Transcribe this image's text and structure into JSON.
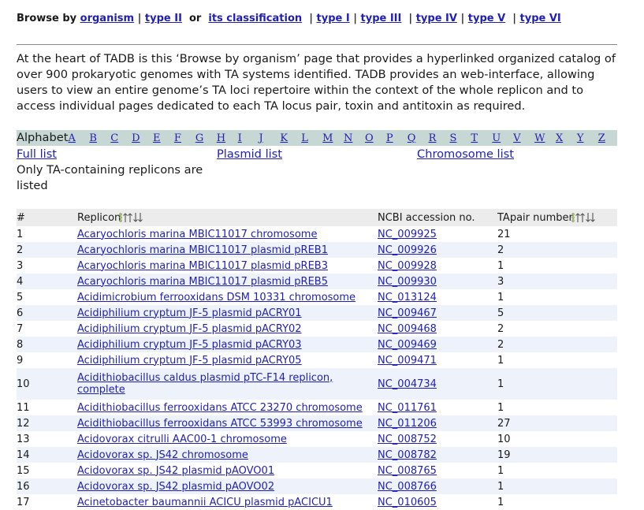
{
  "nav": {
    "prefix": "Browse by",
    "organism": "organism",
    "sep1": "|",
    "type2": "type II",
    "or": "or",
    "classification": "its classification",
    "types": [
      {
        "sep": "|",
        "label": "type I"
      },
      {
        "sep": "|",
        "label": "type III"
      },
      {
        "sep": "|",
        "label": "type IV"
      },
      {
        "sep": "|",
        "label": "type V"
      },
      {
        "sep": "|",
        "label": "type VI"
      }
    ]
  },
  "intro": "At the heart of TADB is this ‘Browse by organism’ page that provides a hyperlinked organized catalog of over 900 prokaryotic genomes with TA systems identified. TADB provides an web-interface, allowing users to view an entire genome’s TA loci repertoire within the context of the whole replicon and to access individual pages dedicated to each TA locus pair, toxin and antitoxin as required.",
  "alphabet": {
    "label": "Alphabet",
    "letters": [
      "A",
      "B",
      "C",
      "D",
      "E",
      "F",
      "G",
      "H",
      "I",
      "J",
      "K",
      "L",
      "M",
      "N",
      "O",
      "P",
      "Q",
      "R",
      "S",
      "T",
      "U",
      "V",
      "W",
      "X",
      "Y",
      "Z"
    ]
  },
  "lists": {
    "full": "Full list",
    "plasmid": "Plasmid list",
    "chromosome": "Chromosome list"
  },
  "note": "Only TA-containing replicons are listed",
  "table": {
    "headers": {
      "num": "#",
      "replicon": "Replicon",
      "accession": "NCBI accession no.",
      "tapair": "TApair number"
    },
    "rows": [
      {
        "num": "1",
        "replicon": "Acaryochloris marina MBIC11017 chromosome",
        "accession": "NC_009925",
        "tapair": "21"
      },
      {
        "num": "2",
        "replicon": "Acaryochloris marina MBIC11017 plasmid pREB1",
        "accession": "NC_009926",
        "tapair": "2"
      },
      {
        "num": "3",
        "replicon": "Acaryochloris marina MBIC11017 plasmid pREB3",
        "accession": "NC_009928",
        "tapair": "1"
      },
      {
        "num": "4",
        "replicon": "Acaryochloris marina MBIC11017 plasmid pREB5",
        "accession": "NC_009930",
        "tapair": "3"
      },
      {
        "num": "5",
        "replicon": "Acidimicrobium ferrooxidans DSM 10331 chromosome",
        "accession": "NC_013124",
        "tapair": "1"
      },
      {
        "num": "6",
        "replicon": "Acidiphilium cryptum JF-5 plasmid pACRY01",
        "accession": "NC_009467",
        "tapair": "5"
      },
      {
        "num": "7",
        "replicon": "Acidiphilium cryptum JF-5 plasmid pACRY02",
        "accession": "NC_009468",
        "tapair": "2"
      },
      {
        "num": "8",
        "replicon": "Acidiphilium cryptum JF-5 plasmid pACRY03",
        "accession": "NC_009469",
        "tapair": "2"
      },
      {
        "num": "9",
        "replicon": "Acidiphilium cryptum JF-5 plasmid pACRY05",
        "accession": "NC_009471",
        "tapair": "1"
      },
      {
        "num": "10",
        "replicon": "Acidithiobacillus caldus plasmid pTC-F14 replicon, complete",
        "accession": "NC_004734",
        "tapair": "1"
      },
      {
        "num": "11",
        "replicon": "Acidithiobacillus ferrooxidans ATCC 23270 chromosome",
        "accession": "NC_011761",
        "tapair": "1"
      },
      {
        "num": "12",
        "replicon": "Acidithiobacillus ferrooxidans ATCC 53993 chromosome",
        "accession": "NC_011206",
        "tapair": "27"
      },
      {
        "num": "13",
        "replicon": "Acidovorax citrulli AAC00-1 chromosome",
        "accession": "NC_008752",
        "tapair": "10"
      },
      {
        "num": "14",
        "replicon": "Acidovorax sp. JS42 chromosome",
        "accession": "NC_008782",
        "tapair": "19"
      },
      {
        "num": "15",
        "replicon": "Acidovorax sp. JS42 plasmid pAOVO01",
        "accession": "NC_008765",
        "tapair": "1"
      },
      {
        "num": "16",
        "replicon": "Acidovorax sp. JS42 plasmid pAOVO02",
        "accession": "NC_008766",
        "tapair": "1"
      },
      {
        "num": "17",
        "replicon": "Acinetobacter baumannii ACICU plasmid pACICU1",
        "accession": "NC_010605",
        "tapair": "1"
      }
    ]
  },
  "colors": {
    "link": "#1f1fb8",
    "alphabet_bar": "#c7d7d3",
    "row_alt": "#eef3fb",
    "header_bg": "#ececec",
    "sort_icon": "#7a9a3a"
  },
  "icons": {
    "sort": "sort-arrows-icon"
  }
}
